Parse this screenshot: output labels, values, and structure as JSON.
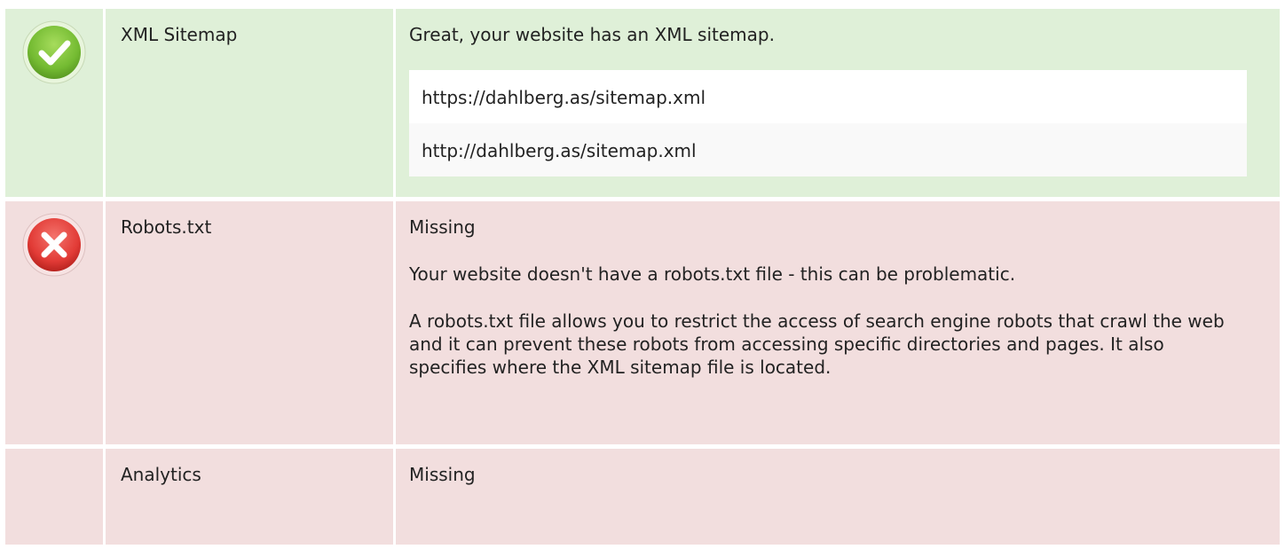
{
  "rows": [
    {
      "status": "success",
      "icon": "check-icon",
      "label": "XML Sitemap",
      "message": "Great, your website has an XML sitemap.",
      "urls": [
        "https://dahlberg.as/sitemap.xml",
        "http://dahlberg.as/sitemap.xml"
      ]
    },
    {
      "status": "error",
      "icon": "x-icon",
      "label": "Robots.txt",
      "message": "Missing",
      "details": [
        "Your website doesn't have a robots.txt file - this can be problematic.",
        "A robots.txt file allows you to restrict the access of search engine robots that crawl the web and it can prevent these robots from accessing specific directories and pages. It also specifies where the XML sitemap file is located."
      ]
    },
    {
      "status": "error",
      "label": "Analytics",
      "message": "Missing"
    }
  ],
  "colors": {
    "success_bg": "#dff0d8",
    "error_bg": "#f2dede",
    "success_icon": "#7dc13b",
    "error_icon": "#e23b36"
  }
}
